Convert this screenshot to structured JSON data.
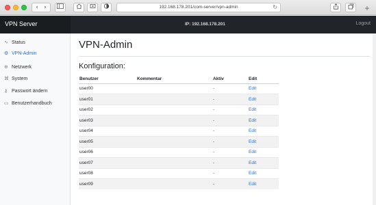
{
  "browser": {
    "url": "192.168.178.201/com-server/vpn-admin",
    "nav_back": "‹",
    "nav_forward": "›"
  },
  "header": {
    "brand": "VPN Server",
    "ip": "IP: 192.168.178.201",
    "logout": "Logout"
  },
  "sidebar": {
    "items": [
      {
        "label": "Status",
        "icon": "pulse-icon",
        "glyph": "∿",
        "active": false
      },
      {
        "label": "VPN-Admin",
        "icon": "gear-icon",
        "glyph": "⚙",
        "active": true
      },
      {
        "label": "Netzwerk",
        "icon": "globe-icon",
        "glyph": "⊕",
        "active": false
      },
      {
        "label": "System",
        "icon": "command-icon",
        "glyph": "⌘",
        "active": false
      },
      {
        "label": "Passwort ändern",
        "icon": "key-icon",
        "glyph": "⚷",
        "active": false
      },
      {
        "label": "Benutzerhandbuch",
        "icon": "book-icon",
        "glyph": "▭",
        "active": false
      }
    ]
  },
  "main": {
    "title": "VPN-Admin",
    "section": "Konfiguration:",
    "columns": [
      "Benutzer",
      "Kommentar",
      "Aktiv",
      "Edit"
    ],
    "rows": [
      {
        "user": "user00",
        "comment": "",
        "active": "-",
        "edit": "Edit"
      },
      {
        "user": "user01",
        "comment": "",
        "active": "-",
        "edit": "Edit"
      },
      {
        "user": "user02",
        "comment": "",
        "active": "-",
        "edit": "Edit"
      },
      {
        "user": "user03",
        "comment": "",
        "active": "-",
        "edit": "Edit"
      },
      {
        "user": "user04",
        "comment": "",
        "active": "-",
        "edit": "Edit"
      },
      {
        "user": "user05",
        "comment": "",
        "active": "-",
        "edit": "Edit"
      },
      {
        "user": "user06",
        "comment": "",
        "active": "-",
        "edit": "Edit"
      },
      {
        "user": "user07",
        "comment": "",
        "active": "-",
        "edit": "Edit"
      },
      {
        "user": "user08",
        "comment": "",
        "active": "-",
        "edit": "Edit"
      },
      {
        "user": "user09",
        "comment": "",
        "active": "-",
        "edit": "Edit"
      }
    ]
  },
  "colors": {
    "accent": "#2470dc",
    "header_bg": "#212529",
    "sidebar_bg": "#f8f9fa"
  }
}
